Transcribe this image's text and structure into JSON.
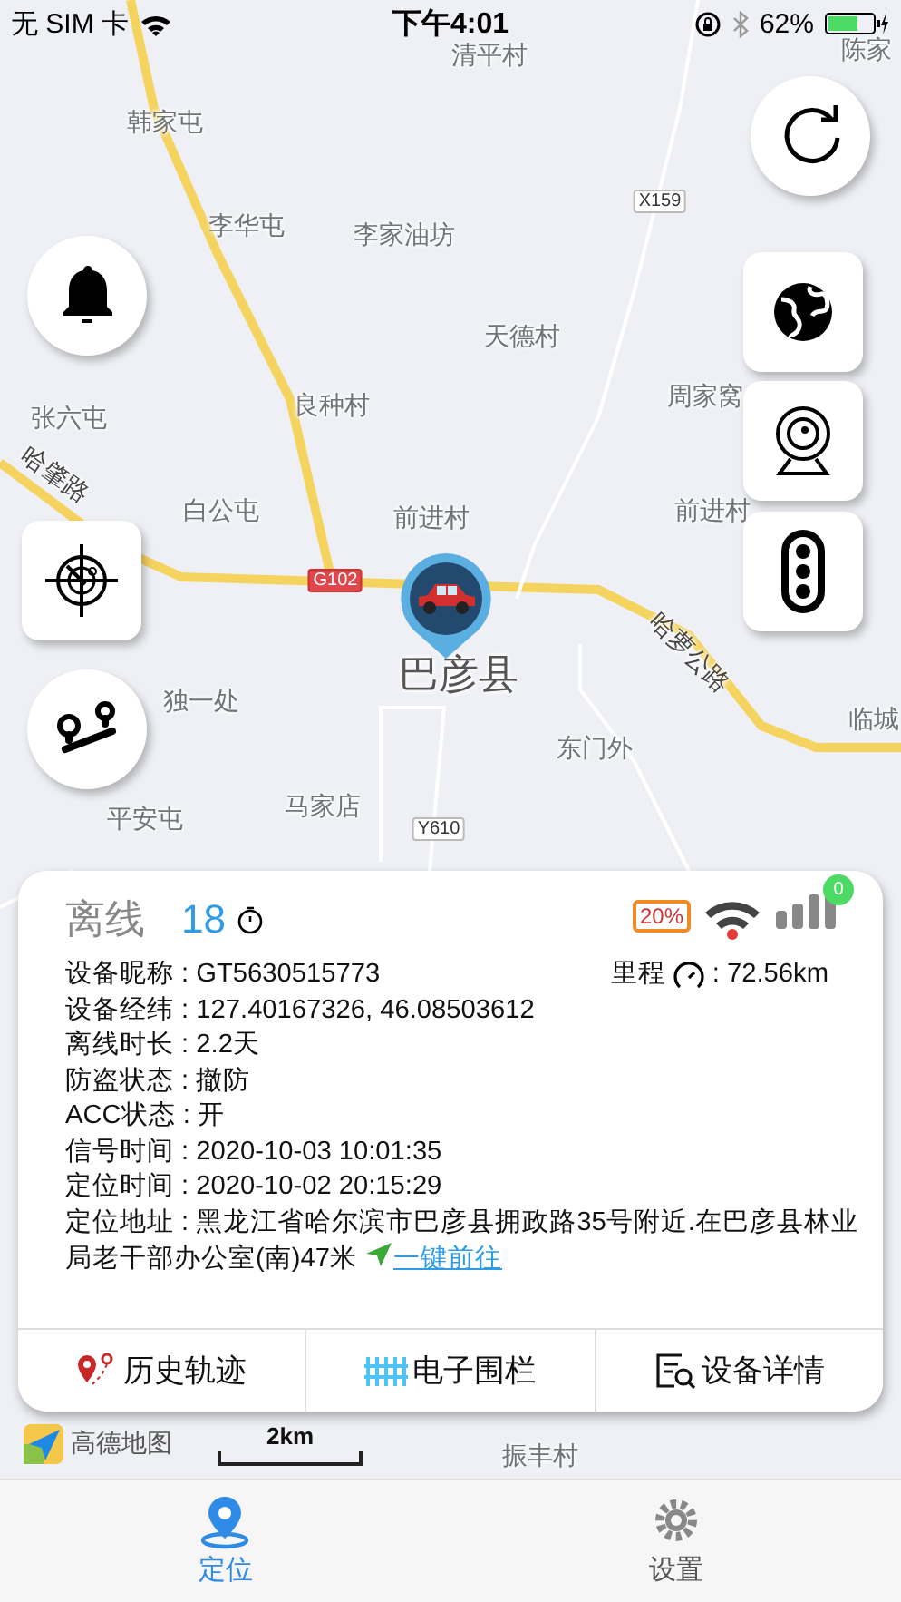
{
  "status_bar": {
    "carrier": "无 SIM 卡",
    "time": "下午4:01",
    "battery": "62%"
  },
  "map": {
    "labels": [
      {
        "text": "清平村",
        "kind": "place"
      },
      {
        "text": "陈家",
        "kind": "place"
      },
      {
        "text": "韩家屯",
        "kind": "place"
      },
      {
        "text": "X159",
        "kind": "shield"
      },
      {
        "text": "李华屯",
        "kind": "place"
      },
      {
        "text": "李家油坊",
        "kind": "place"
      },
      {
        "text": "天德村",
        "kind": "place"
      },
      {
        "text": "良种村",
        "kind": "place"
      },
      {
        "text": "周家窝",
        "kind": "place"
      },
      {
        "text": "张六屯",
        "kind": "place"
      },
      {
        "text": "哈肇路",
        "kind": "road"
      },
      {
        "text": "白公屯",
        "kind": "place"
      },
      {
        "text": "前进村",
        "kind": "place"
      },
      {
        "text": "前进村",
        "kind": "place"
      },
      {
        "text": "G102",
        "kind": "highway"
      },
      {
        "text": "巴彦县",
        "kind": "county"
      },
      {
        "text": "哈萝公路",
        "kind": "road"
      },
      {
        "text": "独一处",
        "kind": "place"
      },
      {
        "text": "东门外",
        "kind": "place"
      },
      {
        "text": "临城",
        "kind": "place"
      },
      {
        "text": "马家店",
        "kind": "place"
      },
      {
        "text": "平安屯",
        "kind": "place"
      },
      {
        "text": "Y610",
        "kind": "shield"
      },
      {
        "text": "振丰村",
        "kind": "place"
      }
    ],
    "attribution": "高德地图",
    "scale": "2km"
  },
  "card": {
    "status": "离线",
    "count": "18",
    "battery": "20%",
    "signal_badge": "0",
    "mileage_label": "里程",
    "mileage_value": ": 72.56km",
    "rows": [
      "设备昵称 : GT5630515773",
      "设备经纬 : 127.40167326, 46.08503612",
      "离线时长 : 2.2天",
      "防盗状态 : 撤防",
      "ACC状态 : 开",
      "信号时间 : 2020-10-03 10:01:35",
      "定位时间 : 2020-10-02 20:15:29"
    ],
    "address": "定位地址 : 黑龙江省哈尔滨市巴彦县拥政路35号附近.在巴彦县林业局老干部办公室(南)47米",
    "navigate": "一键前往",
    "actions": [
      {
        "label": "历史轨迹",
        "kind": "track"
      },
      {
        "label": "电子围栏",
        "kind": "fence"
      },
      {
        "label": "设备详情",
        "kind": "details"
      }
    ]
  },
  "tabs": [
    {
      "label": "定位",
      "kind": "location",
      "selected": true
    },
    {
      "label": "设置",
      "kind": "settings",
      "selected": false
    }
  ]
}
